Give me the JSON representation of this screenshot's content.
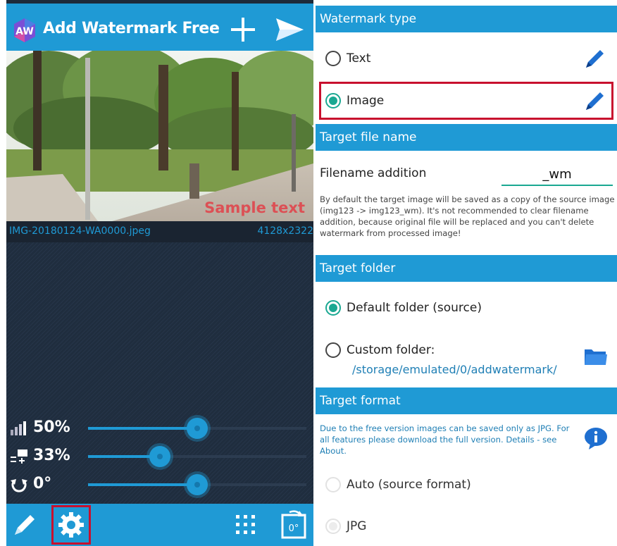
{
  "app": {
    "title": "Add Watermark Free",
    "logo_text": "AW"
  },
  "preview": {
    "sample_text": "Sample text",
    "file_name": "IMG-20180124-WA0000.jpeg",
    "dimensions": "4128x2322"
  },
  "sliders": [
    {
      "icon": "opacity-icon",
      "label": "50%",
      "value": 0.5
    },
    {
      "icon": "size-icon",
      "label": "33%",
      "value": 0.33
    },
    {
      "icon": "rotation-icon",
      "label": "0°",
      "value": 0.5
    }
  ],
  "bottom_bar": {
    "rotate_label": "0°"
  },
  "settings": {
    "watermark_type_header": "Watermark type",
    "text_option": "Text",
    "image_option": "Image",
    "target_file_header": "Target file name",
    "filename_addition_label": "Filename addition",
    "filename_addition_value": "_wm",
    "filename_desc": "By default the target image will be saved as a copy of the source image (img123 -> img123_wm). It's not recommended to clear filename addition, because original file will be replaced and you can't delete watermark from processed image!",
    "target_folder_header": "Target folder",
    "default_folder": "Default folder (source)",
    "custom_folder": "Custom folder:",
    "custom_path": "/storage/emulated/0/addwatermark/",
    "target_format_header": "Target format",
    "format_note": "Due to the free version images can be saved only as JPG. For all features please download the full version. Details - see About.",
    "auto_format": "Auto (source format)",
    "jpg_format": "JPG"
  },
  "colors": {
    "accent": "#1f9ad5",
    "radio_checked": "#1aa892",
    "highlight": "#c8102e",
    "sample_text": "#e0464d"
  }
}
